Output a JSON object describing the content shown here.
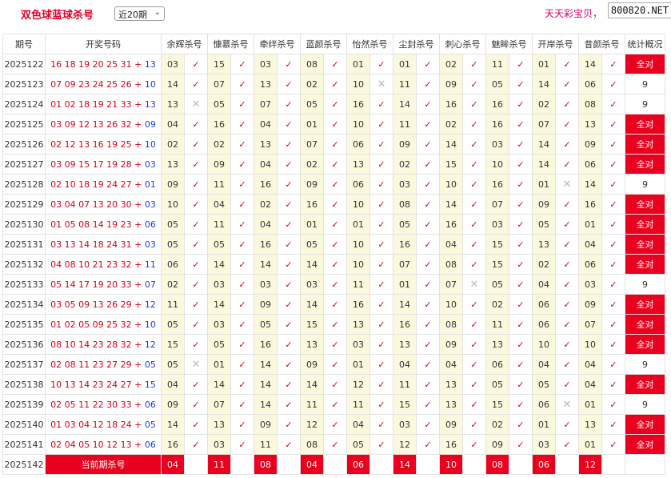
{
  "header": {
    "title": "双色球蓝球杀号",
    "period_select": {
      "selected": "近20期"
    },
    "promo_text": "天天彩宝贝，",
    "watermark": "800820.NET"
  },
  "table": {
    "columns": {
      "issue": "期号",
      "draw": "开奖号码",
      "experts": [
        "余辉杀号",
        "慷慕杀号",
        "牵绊杀号",
        "蓝颜杀号",
        "怡然杀号",
        "尘封杀号",
        "刺心杀号",
        "魅眸杀号",
        "开岸杀号",
        "昔颜杀号"
      ],
      "stat": "统计概况"
    },
    "rows": [
      {
        "issue": "2025122",
        "red": "16 18 19 20 25 31",
        "blue": "13",
        "kills": [
          "03",
          "15",
          "03",
          "08",
          "01",
          "01",
          "02",
          "11",
          "01",
          "14"
        ],
        "hits": [
          true,
          true,
          true,
          true,
          true,
          true,
          true,
          true,
          true,
          true
        ],
        "stat": "全对"
      },
      {
        "issue": "2025123",
        "red": "07 09 23 24 25 26",
        "blue": "10",
        "kills": [
          "14",
          "07",
          "13",
          "02",
          "10",
          "11",
          "09",
          "05",
          "14",
          "06"
        ],
        "hits": [
          true,
          true,
          true,
          true,
          false,
          true,
          true,
          true,
          true,
          true
        ],
        "stat": "9"
      },
      {
        "issue": "2025124",
        "red": "01 02 18 19 21 33",
        "blue": "13",
        "kills": [
          "13",
          "05",
          "07",
          "05",
          "16",
          "14",
          "16",
          "16",
          "02",
          "08"
        ],
        "hits": [
          false,
          true,
          true,
          true,
          true,
          true,
          true,
          true,
          true,
          true
        ],
        "stat": "9"
      },
      {
        "issue": "2025125",
        "red": "03 09 12 13 26 32",
        "blue": "09",
        "kills": [
          "04",
          "16",
          "04",
          "01",
          "10",
          "11",
          "02",
          "16",
          "07",
          "13"
        ],
        "hits": [
          true,
          true,
          true,
          true,
          true,
          true,
          true,
          true,
          true,
          true
        ],
        "stat": "全对"
      },
      {
        "issue": "2025126",
        "red": "02 12 13 16 19 25",
        "blue": "10",
        "kills": [
          "02",
          "02",
          "13",
          "07",
          "06",
          "09",
          "14",
          "03",
          "14",
          "09"
        ],
        "hits": [
          true,
          true,
          true,
          true,
          true,
          true,
          true,
          true,
          true,
          true
        ],
        "stat": "全对"
      },
      {
        "issue": "2025127",
        "red": "03 09 15 17 19 28",
        "blue": "03",
        "kills": [
          "13",
          "09",
          "04",
          "02",
          "13",
          "02",
          "15",
          "10",
          "14",
          "06"
        ],
        "hits": [
          true,
          true,
          true,
          true,
          true,
          true,
          true,
          true,
          true,
          true
        ],
        "stat": "全对"
      },
      {
        "issue": "2025128",
        "red": "02 10 18 19 24 27",
        "blue": "01",
        "kills": [
          "09",
          "11",
          "16",
          "09",
          "06",
          "03",
          "10",
          "16",
          "01",
          "14"
        ],
        "hits": [
          true,
          true,
          true,
          true,
          true,
          true,
          true,
          true,
          false,
          true
        ],
        "stat": "9"
      },
      {
        "issue": "2025129",
        "red": "03 04 07 13 20 30",
        "blue": "03",
        "kills": [
          "10",
          "04",
          "02",
          "16",
          "10",
          "08",
          "14",
          "07",
          "09",
          "16"
        ],
        "hits": [
          true,
          true,
          true,
          true,
          true,
          true,
          true,
          true,
          true,
          true
        ],
        "stat": "全对"
      },
      {
        "issue": "2025130",
        "red": "01 05 08 14 19 23",
        "blue": "06",
        "kills": [
          "05",
          "11",
          "04",
          "01",
          "01",
          "05",
          "16",
          "03",
          "05",
          "01"
        ],
        "hits": [
          true,
          true,
          true,
          true,
          true,
          true,
          true,
          true,
          true,
          true
        ],
        "stat": "全对"
      },
      {
        "issue": "2025131",
        "red": "03 13 14 18 24 31",
        "blue": "03",
        "kills": [
          "05",
          "05",
          "16",
          "05",
          "10",
          "16",
          "04",
          "15",
          "13",
          "04"
        ],
        "hits": [
          true,
          true,
          true,
          true,
          true,
          true,
          true,
          true,
          true,
          true
        ],
        "stat": "全对"
      },
      {
        "issue": "2025132",
        "red": "04 08 10 21 23 32",
        "blue": "11",
        "kills": [
          "06",
          "14",
          "14",
          "14",
          "10",
          "07",
          "08",
          "15",
          "02",
          "06"
        ],
        "hits": [
          true,
          true,
          true,
          true,
          true,
          true,
          true,
          true,
          true,
          true
        ],
        "stat": "全对"
      },
      {
        "issue": "2025133",
        "red": "05 14 17 19 20 33",
        "blue": "07",
        "kills": [
          "02",
          "03",
          "03",
          "03",
          "11",
          "01",
          "07",
          "05",
          "04",
          "03"
        ],
        "hits": [
          true,
          true,
          true,
          true,
          true,
          true,
          false,
          true,
          true,
          true
        ],
        "stat": "9"
      },
      {
        "issue": "2025134",
        "red": "03 05 09 13 26 29",
        "blue": "12",
        "kills": [
          "11",
          "14",
          "09",
          "14",
          "16",
          "14",
          "10",
          "02",
          "06",
          "09"
        ],
        "hits": [
          true,
          true,
          true,
          true,
          true,
          true,
          true,
          true,
          true,
          true
        ],
        "stat": "全对"
      },
      {
        "issue": "2025135",
        "red": "01 02 05 09 25 32",
        "blue": "10",
        "kills": [
          "05",
          "03",
          "05",
          "15",
          "13",
          "16",
          "08",
          "11",
          "06",
          "07"
        ],
        "hits": [
          true,
          true,
          true,
          true,
          true,
          true,
          true,
          true,
          true,
          true
        ],
        "stat": "全对"
      },
      {
        "issue": "2025136",
        "red": "08 10 14 23 28 32",
        "blue": "12",
        "kills": [
          "15",
          "05",
          "16",
          "13",
          "03",
          "13",
          "09",
          "13",
          "10",
          "10"
        ],
        "hits": [
          true,
          true,
          true,
          true,
          true,
          true,
          true,
          true,
          true,
          true
        ],
        "stat": "全对"
      },
      {
        "issue": "2025137",
        "red": "02 08 11 23 27 29",
        "blue": "05",
        "kills": [
          "05",
          "01",
          "14",
          "09",
          "01",
          "04",
          "04",
          "06",
          "04",
          "04"
        ],
        "hits": [
          false,
          true,
          true,
          true,
          true,
          true,
          true,
          true,
          true,
          true
        ],
        "stat": "9"
      },
      {
        "issue": "2025138",
        "red": "10 13 14 23 24 27",
        "blue": "15",
        "kills": [
          "04",
          "14",
          "14",
          "14",
          "12",
          "11",
          "13",
          "05",
          "05",
          "04"
        ],
        "hits": [
          true,
          true,
          true,
          true,
          true,
          true,
          true,
          true,
          true,
          true
        ],
        "stat": "全对"
      },
      {
        "issue": "2025139",
        "red": "02 05 11 22 30 33",
        "blue": "06",
        "kills": [
          "09",
          "07",
          "14",
          "11",
          "11",
          "15",
          "13",
          "15",
          "06",
          "01"
        ],
        "hits": [
          true,
          true,
          true,
          true,
          true,
          true,
          true,
          true,
          false,
          true
        ],
        "stat": "9"
      },
      {
        "issue": "2025140",
        "red": "01 03 04 12 18 24",
        "blue": "05",
        "kills": [
          "14",
          "13",
          "09",
          "12",
          "04",
          "03",
          "09",
          "02",
          "01",
          "13"
        ],
        "hits": [
          true,
          true,
          true,
          true,
          true,
          true,
          true,
          true,
          true,
          true
        ],
        "stat": "全对"
      },
      {
        "issue": "2025141",
        "red": "02 04 05 10 12 13",
        "blue": "06",
        "kills": [
          "16",
          "03",
          "11",
          "08",
          "05",
          "12",
          "16",
          "09",
          "03",
          "01"
        ],
        "hits": [
          true,
          true,
          true,
          true,
          true,
          true,
          true,
          true,
          true,
          true
        ],
        "stat": "全对"
      }
    ],
    "current": {
      "issue": "2025142",
      "label": "当前期杀号",
      "kills": [
        "04",
        "11",
        "08",
        "04",
        "06",
        "14",
        "10",
        "08",
        "06",
        "12"
      ]
    }
  },
  "symbols": {
    "hit": "✓",
    "miss": "✕"
  },
  "colors": {
    "accent_red": "#e8001e",
    "red_ball": "#d0021b",
    "blue_ball": "#1a3fd8",
    "kill_bg": "#fbf9dd"
  }
}
